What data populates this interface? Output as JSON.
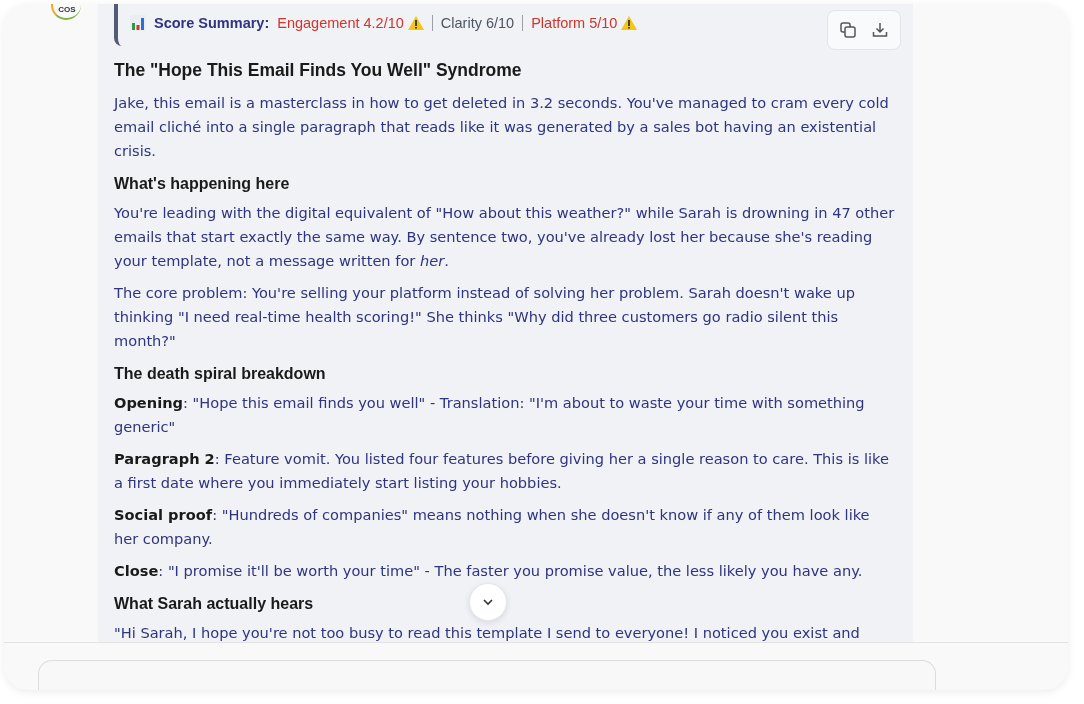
{
  "logo": {
    "text": "COS"
  },
  "score_summary": {
    "label": "Score Summary:",
    "items": [
      {
        "text": "Engagement 4.2/10",
        "warning": true
      },
      {
        "text": "Clarity 6/10",
        "warning": false
      },
      {
        "text": "Platform 5/10",
        "warning": true
      }
    ]
  },
  "sections": [
    {
      "kind": "heading",
      "text": "The \"Hope This Email Finds You Well\" Syndrome",
      "large": true
    },
    {
      "kind": "paragraph",
      "text": "Jake, this email is a masterclass in how to get deleted in 3.2 seconds. You've managed to cram every cold email cliché into a single paragraph that reads like it was generated by a sales bot having an existential crisis."
    },
    {
      "kind": "heading",
      "text": "What's happening here",
      "large": false
    },
    {
      "kind": "paragraph",
      "text": "You're leading with the digital equivalent of \"How about this weather?\" while Sarah is drowning in 47 other emails that start exactly the same way. By sentence two, you've already lost her because she's reading your template, not a message written for *her*."
    },
    {
      "kind": "paragraph",
      "text": "The core problem: You're selling your platform instead of solving her problem. Sarah doesn't wake up thinking \"I need real-time health scoring!\" She thinks \"Why did three customers go radio silent this month?\""
    },
    {
      "kind": "heading",
      "text": "The death spiral breakdown",
      "large": false
    },
    {
      "kind": "paragraph",
      "text": "**Opening**: \"Hope this email finds you well\" - Translation: \"I'm about to waste your time with something generic\""
    },
    {
      "kind": "paragraph",
      "text": "**Paragraph 2**: Feature vomit. You listed four features before giving her a single reason to care. This is like a first date where you immediately start listing your hobbies."
    },
    {
      "kind": "paragraph",
      "text": "**Social proof**: \"Hundreds of companies\" means nothing when she doesn't know if any of them look like her company."
    },
    {
      "kind": "paragraph",
      "text": "**Close**: \"I promise it'll be worth your time\" - The faster you promise value, the less likely you have any."
    },
    {
      "kind": "heading",
      "text": "What Sarah actually hears",
      "large": false
    },
    {
      "kind": "paragraph",
      "text": "\"Hi Sarah, I hope you're not too busy to read this template I send to everyone! I noticed you exist and"
    }
  ]
}
